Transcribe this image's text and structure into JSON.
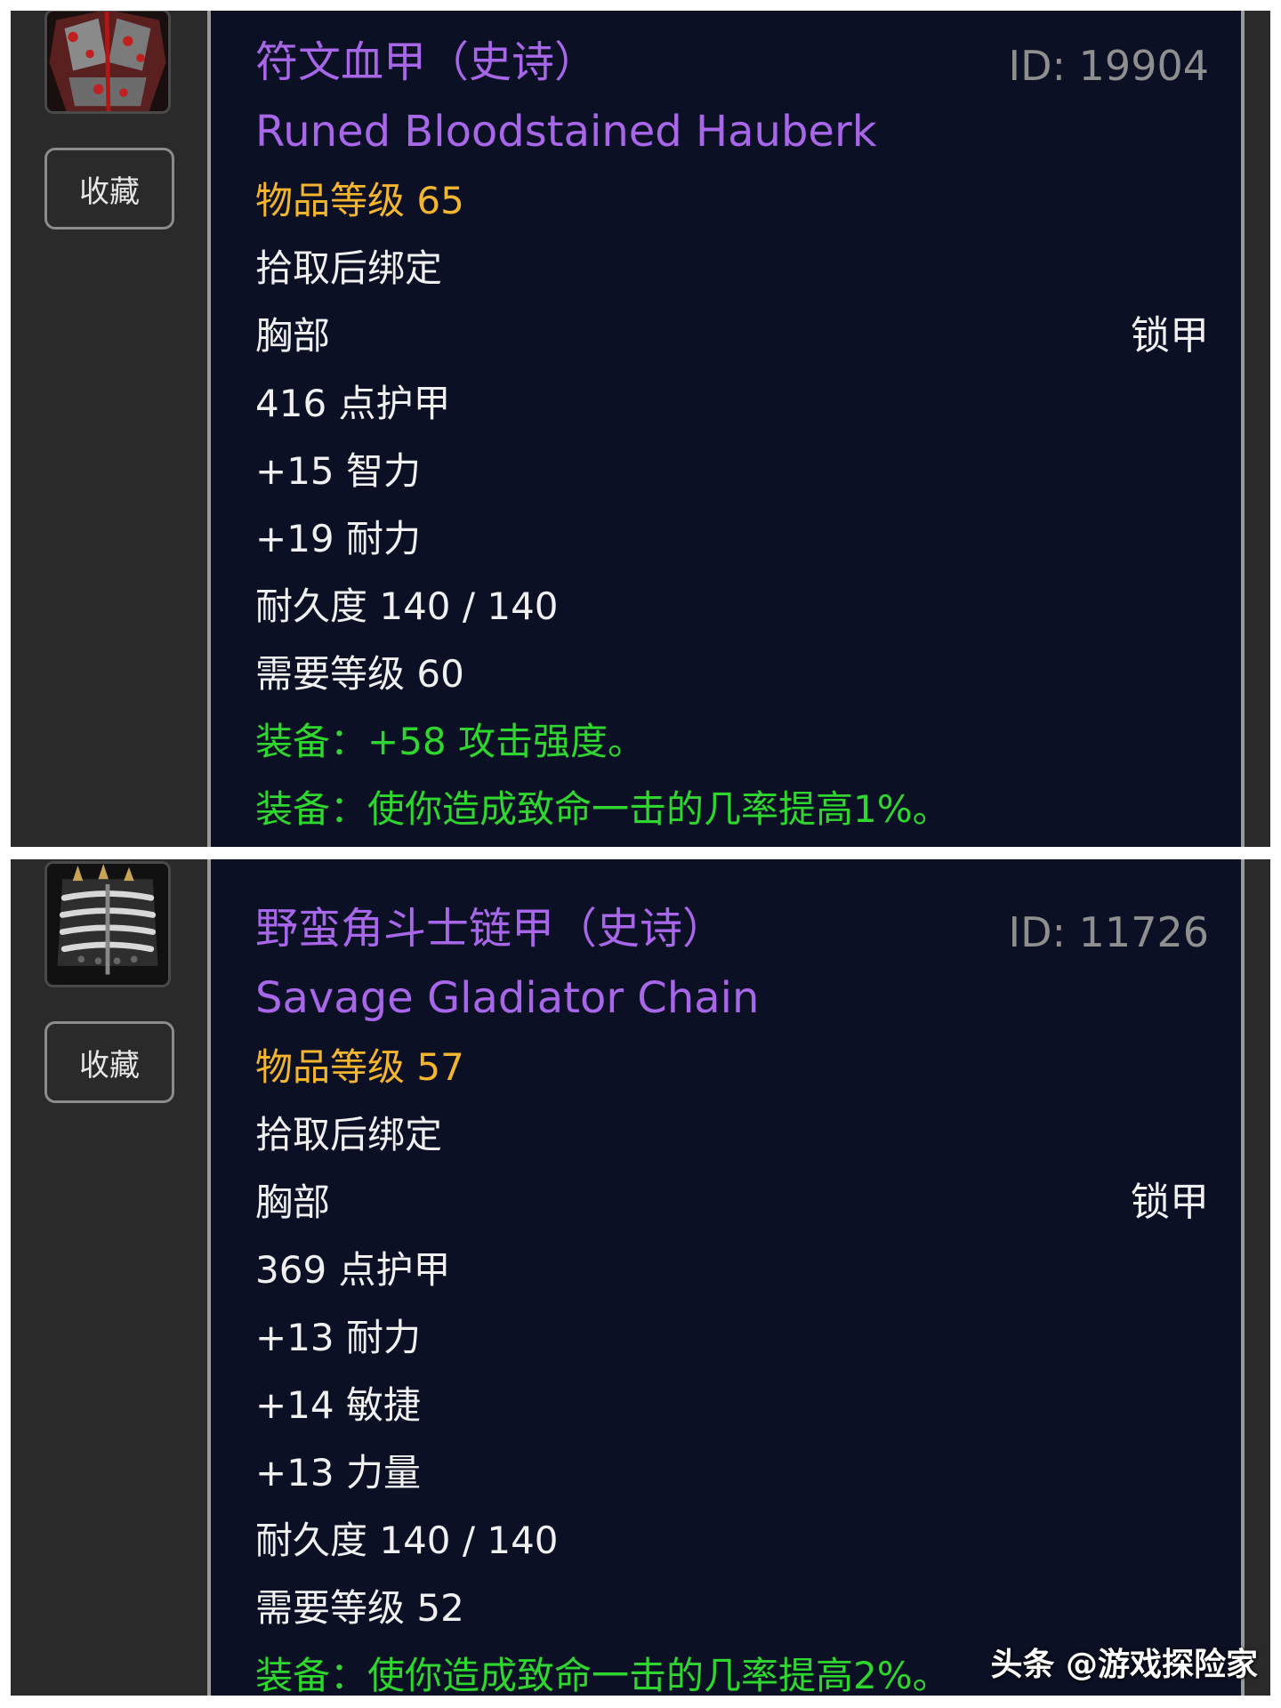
{
  "items": [
    {
      "icon": "chest-armor-red-icon",
      "favorite_label": "收藏",
      "title": "符文血甲（史诗）",
      "id_label": "ID: 19904",
      "english_name": "Runed Bloodstained Hauberk",
      "item_level": "物品等级 65",
      "binding": "拾取后绑定",
      "slot": "胸部",
      "armor_type": "锁甲",
      "stats": [
        "416 点护甲",
        "+15 智力",
        "+19 耐力",
        "耐久度 140 / 140",
        "需要等级 60"
      ],
      "effects": [
        "装备：+58 攻击强度。",
        "装备：使你造成致命一击的几率提高1%。"
      ]
    },
    {
      "icon": "chain-armor-spiked-icon",
      "favorite_label": "收藏",
      "title": "野蛮角斗士链甲（史诗）",
      "id_label": "ID: 11726",
      "english_name": "Savage Gladiator Chain",
      "item_level": "物品等级 57",
      "binding": "拾取后绑定",
      "slot": "胸部",
      "armor_type": "锁甲",
      "stats": [
        "369 点护甲",
        "+13 耐力",
        "+14 敏捷",
        "+13 力量",
        "耐久度 140 / 140",
        "需要等级 52"
      ],
      "effects": [
        "装备：使你造成致命一击的几率提高2%。"
      ]
    }
  ],
  "watermark": "头条 @游戏探险家",
  "colors": {
    "epic": "#a866e8",
    "item_level": "#f4b52e",
    "effect": "#2fd62f",
    "tooltip_bg": "#0b1024",
    "panel_bg": "#2a2a2a"
  }
}
